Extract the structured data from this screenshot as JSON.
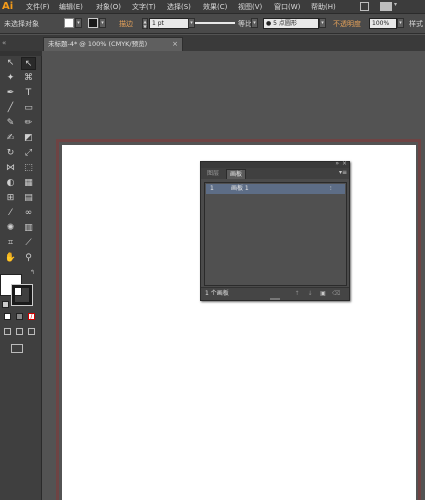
{
  "app": {
    "logo": "Ai"
  },
  "menu": {
    "items": [
      "文件(F)",
      "编辑(E)",
      "对象(O)",
      "文字(T)",
      "选择(S)",
      "效果(C)",
      "视图(V)",
      "窗口(W)",
      "帮助(H)"
    ]
  },
  "control_bar": {
    "selection_label": "未选择对象",
    "stroke_label": "描边",
    "stroke_weight": "1 pt",
    "stroke_profile": "等比",
    "brush": "5 点圆形",
    "opacity_label": "不透明度",
    "opacity_value": "100%",
    "style_label": "样式"
  },
  "document_tab": {
    "title": "未标题-4* @ 100% (CMYK/预览)",
    "close": "×"
  },
  "artboards_panel": {
    "tabs": [
      "图层",
      "画板"
    ],
    "active_tab": "画板",
    "rows": [
      {
        "index": "1",
        "name": "画板 1"
      }
    ],
    "footer_count": "1 个画板"
  },
  "colors": {
    "ui_dark": "#3c3c3c",
    "canvas": "#535353",
    "artboard": "#ffffff",
    "artboard_border": "#6e4343",
    "selected_row": "#5d6d86",
    "accent": "#f59b19"
  }
}
